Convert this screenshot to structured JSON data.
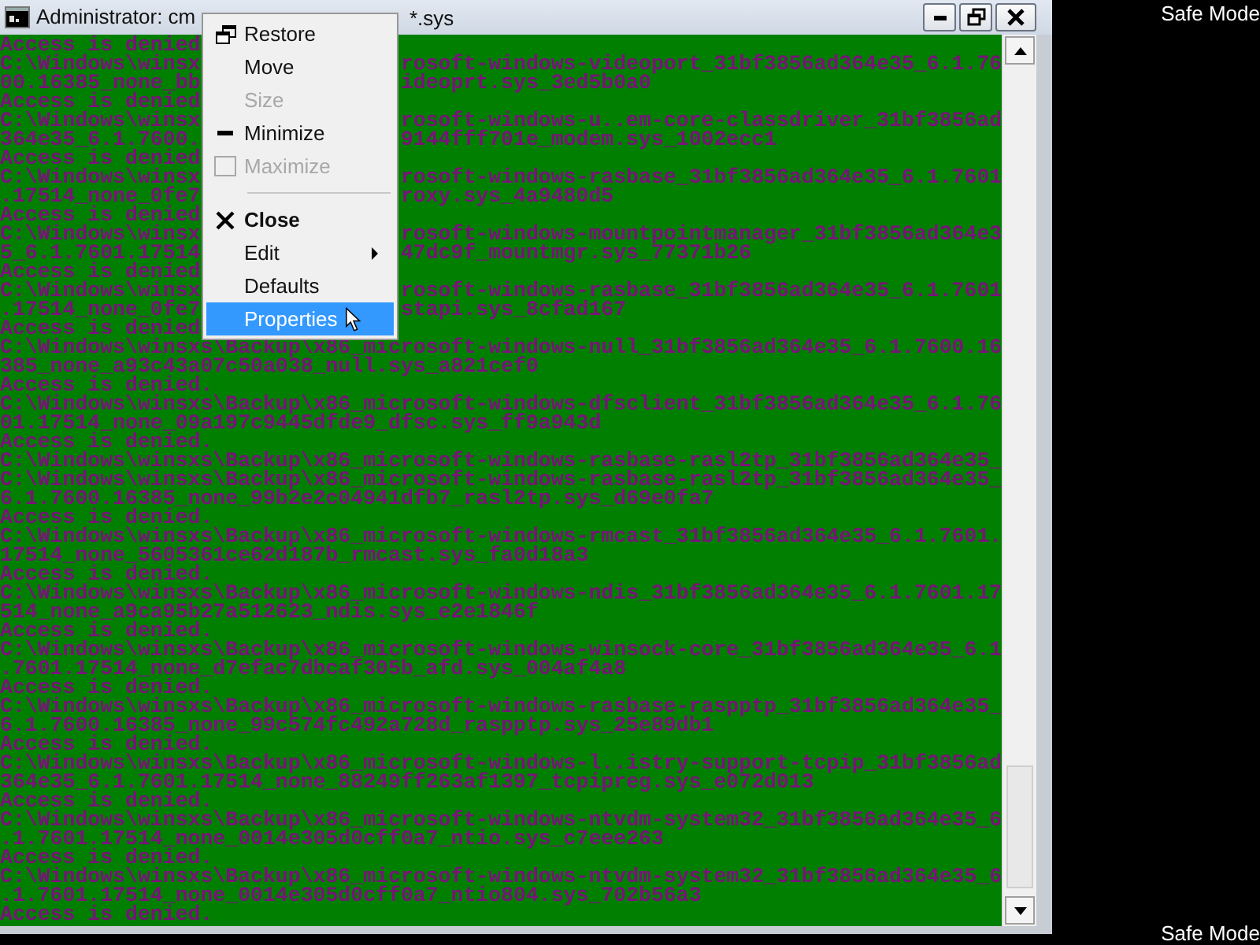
{
  "window": {
    "title_left": "Administrator: cm",
    "title_right": "*.sys"
  },
  "console": {
    "lines": [
      {
        "left": "Access is denied"
      },
      {
        "left": "C:\\Windows\\winsx",
        "right": "rosoft-windows-videoport_31bf3856ad364e35_6.1.76"
      },
      {
        "left": "00.16385_none_bb",
        "right": "ideoprt.sys_3ed5b0a0"
      },
      {
        "left": "Access is denied"
      },
      {
        "left": "C:\\Windows\\winsx",
        "right": "rosoft-windows-u..em-core-classdriver_31bf3856ad"
      },
      {
        "left": "364e35_6.1.7600.",
        "right": "9144fff701e_modem.sys_1002ecc1"
      },
      {
        "left": "Access is denied"
      },
      {
        "left": "C:\\Windows\\winsx",
        "right": "rosoft-windows-rasbase_31bf3856ad364e35_6.1.7601"
      },
      {
        "left": ".17514_none_0fe7",
        "right": "roxy.sys_4a9480d5"
      },
      {
        "left": "Access is denied"
      },
      {
        "left": "C:\\Windows\\winsx",
        "right": "rosoft-windows-mountpointmanager_31bf3856ad364e3"
      },
      {
        "left": "5_6.1.7601.17514",
        "right": "47dc9f_mountmgr.sys_77371b26"
      },
      {
        "left": "Access is denied"
      },
      {
        "left": "C:\\Windows\\winsx",
        "right": "rosoft-windows-rasbase_31bf3856ad364e35_6.1.7601"
      },
      {
        "left": ".17514_none_0fe7",
        "right": "stapi.sys_8cfad167"
      },
      {
        "left": "Access is denied"
      },
      {
        "left": "C:\\Windows\\winsxs\\Backup\\x86_microsoft-windows-null_31bf3856ad364e35_6.1.7600.16"
      },
      {
        "left": "385_none_a93c43a07c50a038_null.sys_a821cef0"
      },
      {
        "left": "Access is denied."
      },
      {
        "left": "C:\\Windows\\winsxs\\Backup\\x86_microsoft-windows-dfsclient_31bf3856ad364e35_6.1.76"
      },
      {
        "left": "01.17514_none_09a197c9445dfde9_dfsc.sys_ff9a943d"
      },
      {
        "left": "Access is denied."
      },
      {
        "left": "C:\\Windows\\winsxs\\Backup\\x86_microsoft-windows-rasbase-rasl2tp_31bf3856ad364e35_"
      },
      {
        "left": "C:\\Windows\\winsxs\\Backup\\x86_microsoft-windows-rasbase-rasl2tp_31bf3856ad364e35_"
      },
      {
        "left": "6.1.7600.16385_none_99b2e2c04941dfb7_rasl2tp.sys_d69e0fa7"
      },
      {
        "left": "Access is denied."
      },
      {
        "left": "C:\\Windows\\winsxs\\Backup\\x86_microsoft-windows-rmcast_31bf3856ad364e35_6.1.7601."
      },
      {
        "left": "17514_none_5605361ce62d187b_rmcast.sys_fa0d18a3"
      },
      {
        "left": "Access is denied."
      },
      {
        "left": "C:\\Windows\\winsxs\\Backup\\x86_microsoft-windows-ndis_31bf3856ad364e35_6.1.7601.17"
      },
      {
        "left": "514_none_a9ca95b27a512623_ndis.sys_e2e1846f"
      },
      {
        "left": "Access is denied."
      },
      {
        "left": "C:\\Windows\\winsxs\\Backup\\x86_microsoft-windows-winsock-core_31bf3856ad364e35_6.1"
      },
      {
        "left": ".7601.17514_none_d7efac7dbcaf305b_afd.sys_004af4a8"
      },
      {
        "left": "Access is denied."
      },
      {
        "left": "C:\\Windows\\winsxs\\Backup\\x86_microsoft-windows-rasbase-raspptp_31bf3856ad364e35_"
      },
      {
        "left": "6.1.7600.16385_none_99c574fc492a728d_raspptp.sys_25e89db1"
      },
      {
        "left": "Access is denied."
      },
      {
        "left": "C:\\Windows\\winsxs\\Backup\\x86_microsoft-windows-l..istry-support-tcpip_31bf3856ad"
      },
      {
        "left": "364e35_6.1.7601.17514_none_88249ff263af1397_tcpipreg.sys_e072d013"
      },
      {
        "left": "Access is denied."
      },
      {
        "left": "C:\\Windows\\winsxs\\Backup\\x86_microsoft-windows-ntvdm-system32_31bf3856ad364e35_6"
      },
      {
        "left": ".1.7601.17514_none_0014e305d0cff0a7_ntio.sys_c7eee263"
      },
      {
        "left": "Access is denied."
      },
      {
        "left": "C:\\Windows\\winsxs\\Backup\\x86_microsoft-windows-ntvdm-system32_31bf3856ad364e35_6"
      },
      {
        "left": ".1.7601.17514_none_0014e305d0cff0a7_ntio804.sys_702b56a3"
      },
      {
        "left": "Access is denied."
      }
    ]
  },
  "system_menu": {
    "items": [
      {
        "kind": "restore",
        "label": "Restore",
        "disabled": false,
        "selected": false
      },
      {
        "kind": "plain",
        "label": "Move",
        "disabled": false,
        "selected": false
      },
      {
        "kind": "plain",
        "label": "Size",
        "disabled": true,
        "selected": false
      },
      {
        "kind": "minimize",
        "label": "Minimize",
        "disabled": false,
        "selected": false
      },
      {
        "kind": "maximize",
        "label": "Maximize",
        "disabled": true,
        "selected": false
      },
      {
        "kind": "separator"
      },
      {
        "kind": "close",
        "label": "Close",
        "disabled": false,
        "selected": false
      },
      {
        "kind": "submenu",
        "label": "Edit",
        "disabled": false,
        "selected": false
      },
      {
        "kind": "plain",
        "label": "Defaults",
        "disabled": false,
        "selected": false
      },
      {
        "kind": "plain",
        "label": "Properties",
        "disabled": false,
        "selected": true
      }
    ]
  },
  "desktop": {
    "safe_mode_labels": [
      "Safe Mode",
      "Safe Mode"
    ]
  }
}
